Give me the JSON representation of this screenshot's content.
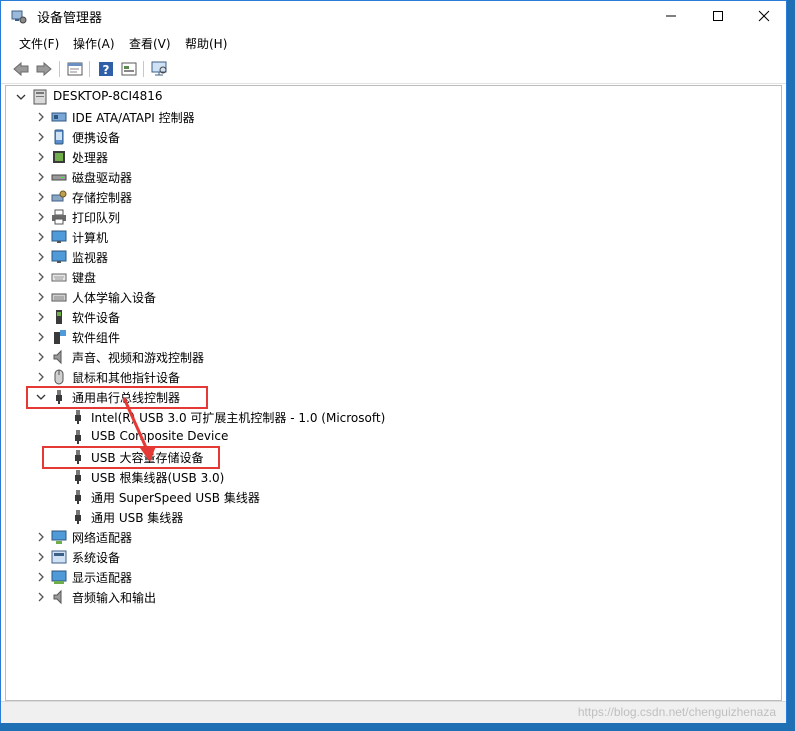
{
  "window": {
    "title": "设备管理器"
  },
  "menu": [
    "文件(F)",
    "操作(A)",
    "查看(V)",
    "帮助(H)"
  ],
  "toolbar": [
    "back-icon",
    "forward-icon",
    "properties-icon",
    "help-icon",
    "update-driver-icon",
    "scan-hardware-icon"
  ],
  "tree": {
    "root": "DESKTOP-8CI4816",
    "categories": [
      "IDE ATA/ATAPI 控制器",
      "便携设备",
      "处理器",
      "磁盘驱动器",
      "存储控制器",
      "打印队列",
      "计算机",
      "监视器",
      "键盘",
      "人体学输入设备",
      "软件设备",
      "软件组件",
      "声音、视频和游戏控制器",
      "鼠标和其他指针设备",
      "通用串行总线控制器",
      "网络适配器",
      "系统设备",
      "显示适配器",
      "音频输入和输出"
    ],
    "usb_children": [
      "Intel(R) USB 3.0 可扩展主机控制器 - 1.0 (Microsoft)",
      "USB Composite Device",
      "USB 大容量存储设备",
      "USB 根集线器(USB 3.0)",
      "通用 SuperSpeed USB 集线器",
      "通用 USB 集线器"
    ]
  },
  "watermark": "https://blog.csdn.net/chenguizhenaza",
  "colors": {
    "highlight": "#e53935",
    "accent": "#2b7bd8"
  }
}
